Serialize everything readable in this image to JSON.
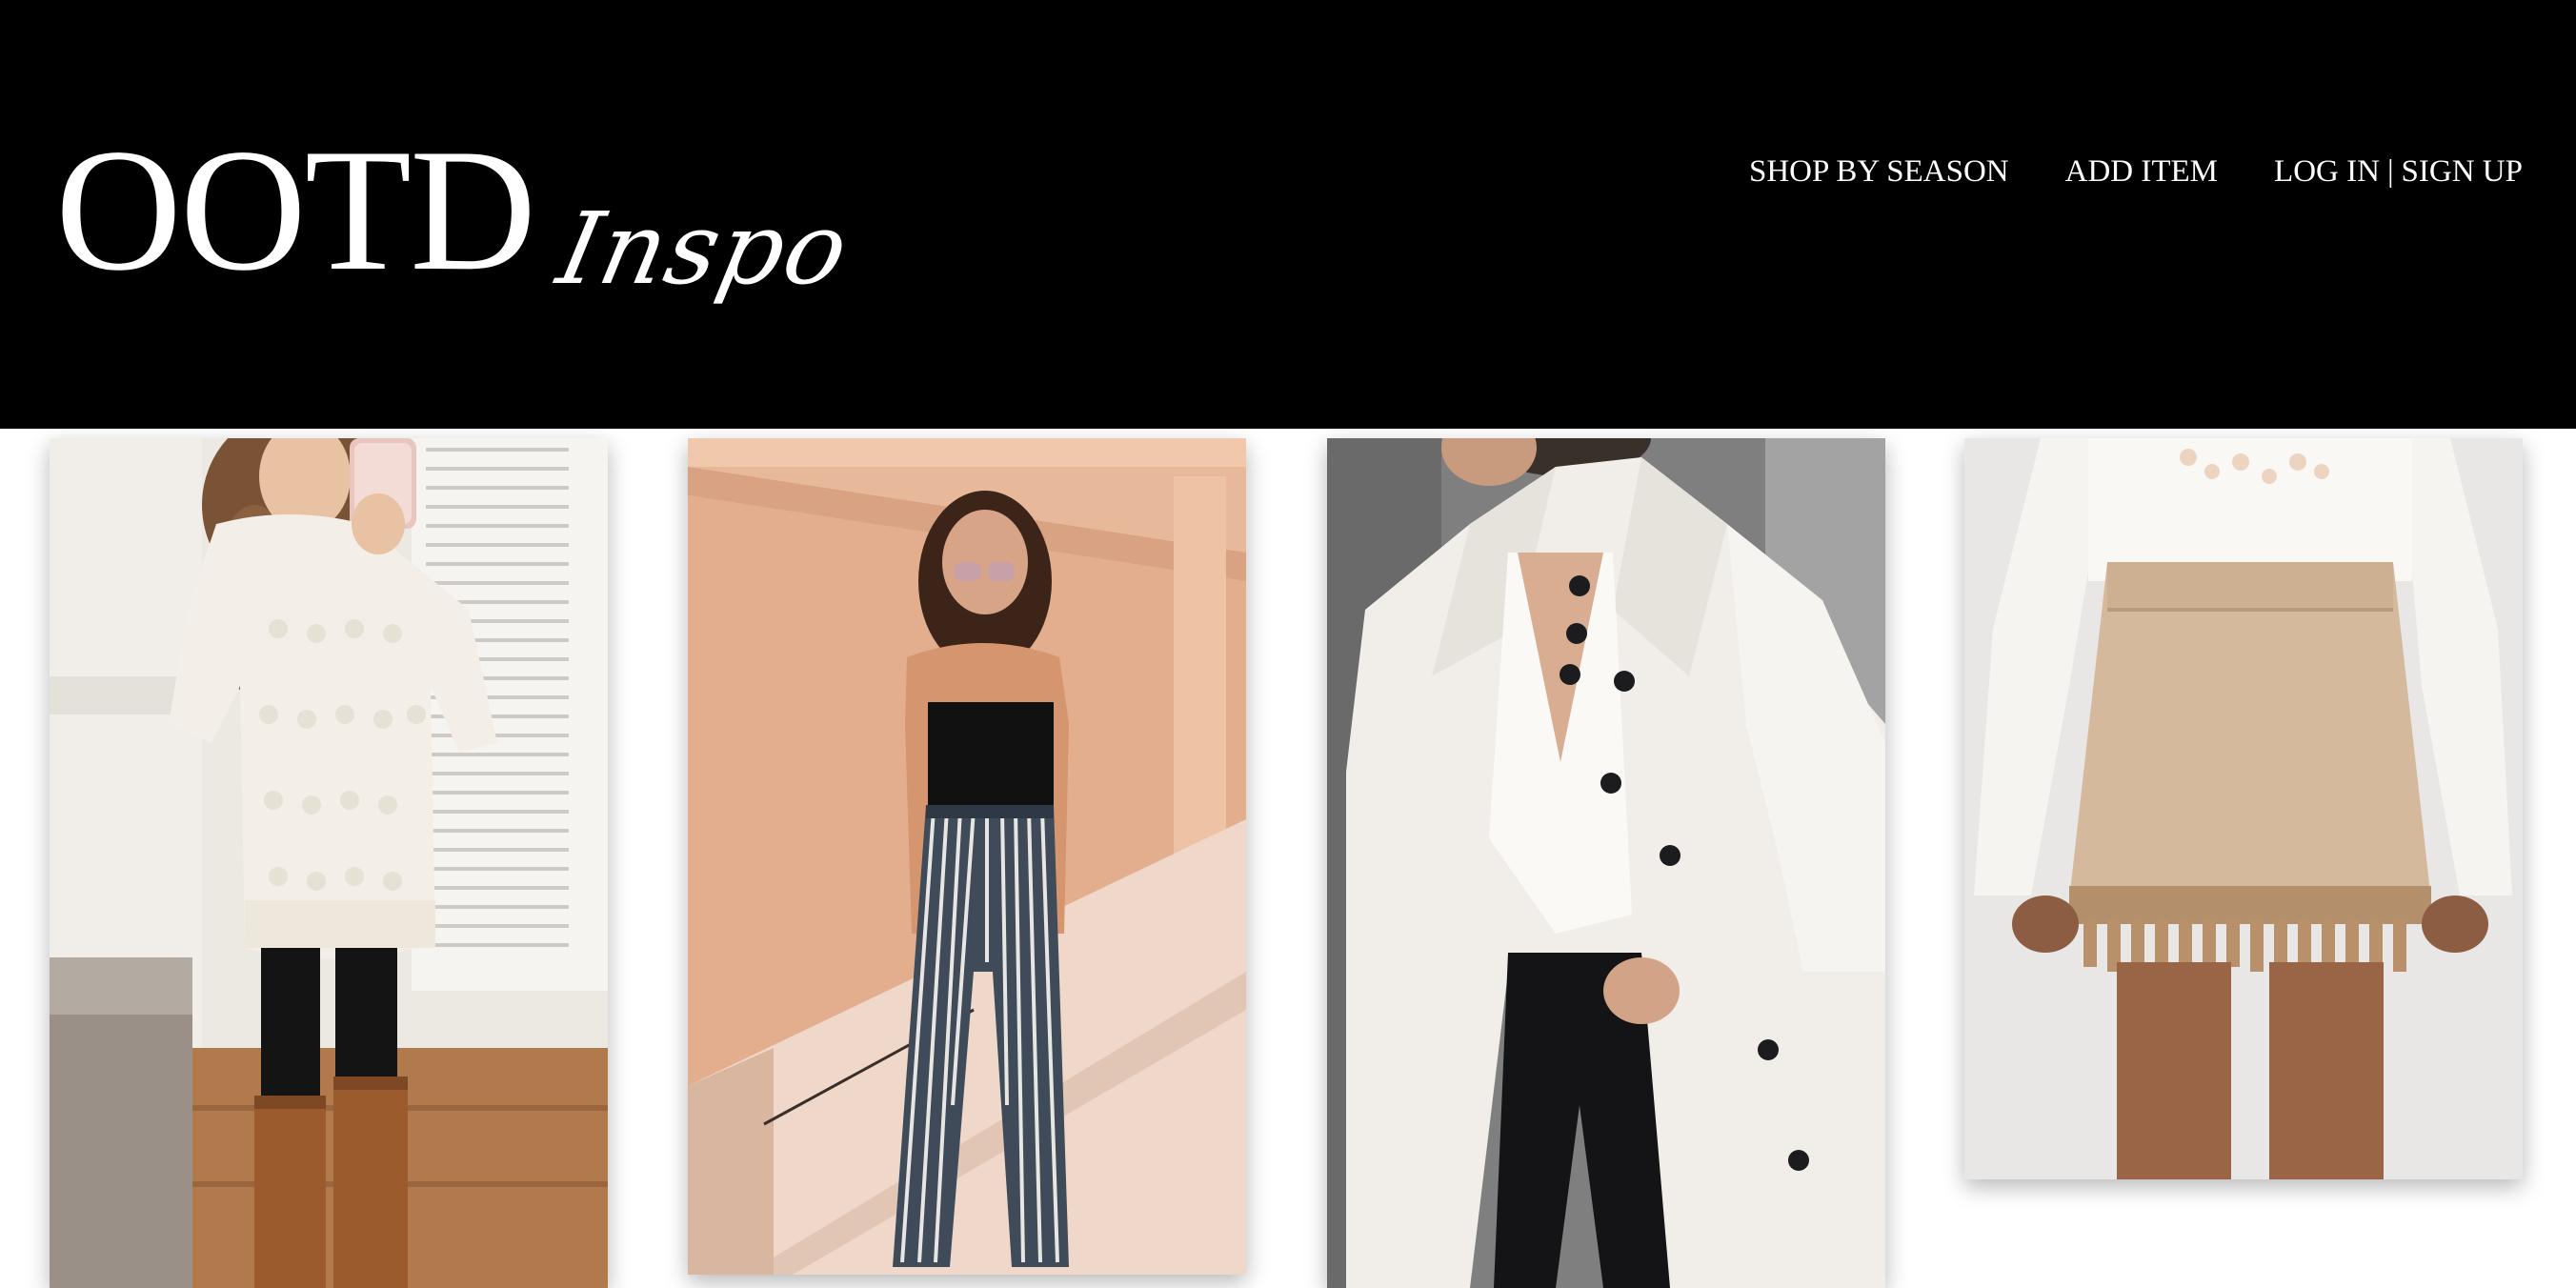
{
  "header": {
    "logo_main": "OOTD",
    "logo_script": "Inspo",
    "nav": {
      "shop_by_season": "SHOP BY SEASON",
      "add_item": "ADD ITEM",
      "log_in": "LOG IN",
      "separator": "|",
      "sign_up": "SIGN UP"
    }
  },
  "gallery": {
    "items": [
      {
        "name": "outfit-white-sweater-brown-boots"
      },
      {
        "name": "outfit-black-tube-top-striped-pants"
      },
      {
        "name": "outfit-white-coat-black-jeans"
      },
      {
        "name": "outfit-tan-tassel-skirt"
      }
    ]
  },
  "colors": {
    "header_bg": "#000000",
    "header_text": "#ffffff",
    "page_bg": "#ffffff"
  }
}
